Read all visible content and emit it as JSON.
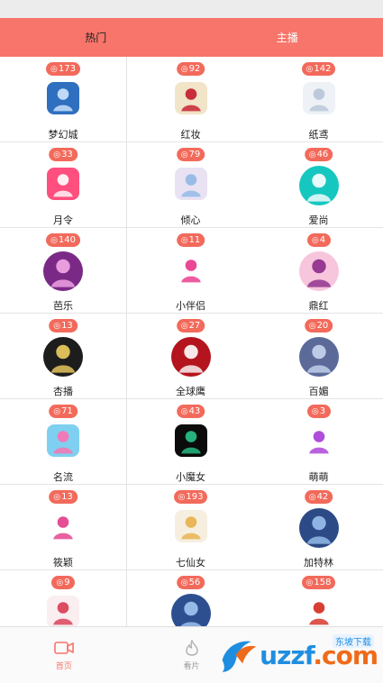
{
  "tabs": [
    {
      "label": "热门"
    },
    {
      "label": "主播"
    }
  ],
  "channels": [
    {
      "name": "梦幻城",
      "count": "173",
      "icon": "blue-tile-icon",
      "bg": "#2f6fbf",
      "fg": "#cfe6ff",
      "round": false
    },
    {
      "name": "红妆",
      "count": "92",
      "icon": "rose-icon",
      "bg": "#f2e4c8",
      "fg": "#c21a2a",
      "round": false
    },
    {
      "name": "纸鸢",
      "count": "142",
      "icon": "girl-white-icon",
      "bg": "#eef2f7",
      "fg": "#b6c4d6",
      "round": false
    },
    {
      "name": "月令",
      "count": "33",
      "icon": "pink-play-icon",
      "bg": "#ff4f7e",
      "fg": "#ffffff",
      "round": false
    },
    {
      "name": "倾心",
      "count": "79",
      "icon": "anime-couple-icon",
      "bg": "#e9e2f3",
      "fg": "#8fb8e6",
      "round": false
    },
    {
      "name": "爱尚",
      "count": "46",
      "icon": "cyan-camera-icon",
      "bg": "#16c7c0",
      "fg": "#ffffff",
      "round": true
    },
    {
      "name": "芭乐",
      "count": "140",
      "icon": "purple-silhouette-icon",
      "bg": "#7a2a86",
      "fg": "#f5a9e8",
      "round": true
    },
    {
      "name": "小伴侣",
      "count": "11",
      "icon": "pink-card-icon",
      "bg": "#ffffff",
      "fg": "#e8338a",
      "round": false
    },
    {
      "name": "鼎红",
      "count": "4",
      "icon": "woman-profile-icon",
      "bg": "#f7c6dd",
      "fg": "#8b2a8a",
      "round": true
    },
    {
      "name": "杏播",
      "count": "13",
      "icon": "x-logo-icon",
      "bg": "#1d1d1d",
      "fg": "#f1d060",
      "round": true
    },
    {
      "name": "全球鹰",
      "count": "27",
      "icon": "dancer-red-icon",
      "bg": "#b4141e",
      "fg": "#ffffff",
      "round": true
    },
    {
      "name": "百媚",
      "count": "20",
      "icon": "fantasy-girl-icon",
      "bg": "#5c6a9a",
      "fg": "#c8d6f0",
      "round": true
    },
    {
      "name": "名流",
      "count": "71",
      "icon": "rainbow-tile-icon",
      "bg": "#7fd0f0",
      "fg": "#ff6fb0",
      "round": false
    },
    {
      "name": "小魔女",
      "count": "43",
      "icon": "dark-tile-icon",
      "bg": "#0b0b0b",
      "fg": "#28c48a",
      "round": false
    },
    {
      "name": "萌萌",
      "count": "3",
      "icon": "m-logo-icon",
      "bg": "#ffffff",
      "fg": "#a63bd6",
      "round": false
    },
    {
      "name": "筱颖",
      "count": "13",
      "icon": "colorful-swirl-icon",
      "bg": "#ffffff",
      "fg": "#e23a8a",
      "round": false
    },
    {
      "name": "七仙女",
      "count": "193",
      "icon": "doll-girl-icon",
      "bg": "#f6efe0",
      "fg": "#e7b04a",
      "round": false
    },
    {
      "name": "加特林",
      "count": "42",
      "icon": "warrior-blue-icon",
      "bg": "#2c4a86",
      "fg": "#9ac0ee",
      "round": true
    },
    {
      "name": "",
      "count": "9",
      "icon": "girl-red-dress-icon",
      "bg": "#fbeef0",
      "fg": "#d83a52",
      "round": false
    },
    {
      "name": "",
      "count": "56",
      "icon": "blue-fantasy-icon",
      "bg": "#2e4f8f",
      "fg": "#a3c6f2",
      "round": true
    },
    {
      "name": "",
      "count": "158",
      "icon": "chili-icon",
      "bg": "#ffffff",
      "fg": "#d42a1e",
      "round": false
    }
  ],
  "bottom_nav": [
    {
      "label": "首页",
      "icon": "video-camera-icon",
      "active": true
    },
    {
      "label": "看片",
      "icon": "flame-icon",
      "active": false
    },
    {
      "label": "",
      "icon": "",
      "active": false
    }
  ],
  "watermark": {
    "text": "uzzf",
    "tld": ".com",
    "tag": "东坡下载"
  },
  "colors": {
    "accent": "#f7756a",
    "badge": "#f26a5b"
  }
}
